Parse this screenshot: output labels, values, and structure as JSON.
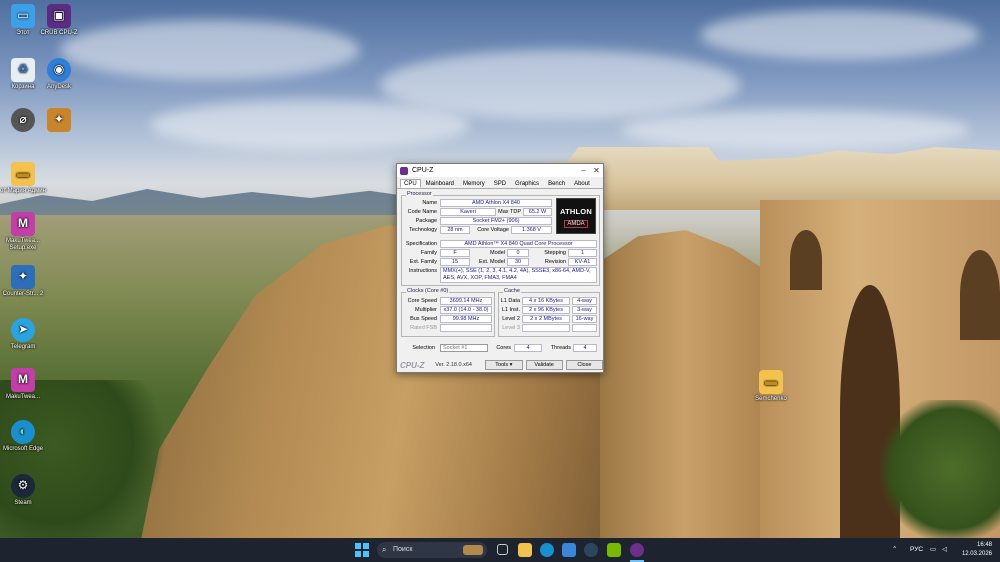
{
  "desktop": {
    "icons": [
      {
        "label": "Этот",
        "icon": "monitor-icon",
        "color": "#3aa0e8"
      },
      {
        "label": "CRUB CPU-Z",
        "icon": "cpu-z-icon",
        "color": "#5a2d82"
      },
      {
        "label": "Корзина",
        "icon": "recycle-bin-icon",
        "color": "#e9eef3"
      },
      {
        "label": "AnyDesk",
        "icon": "anydesk-icon",
        "color": "#2f7fd8"
      },
      {
        "label": "",
        "icon": "app-icon",
        "color": "#555"
      },
      {
        "label": "",
        "icon": "counter-strike-icon",
        "color": "#c9852b"
      },
      {
        "label": "от Мария Админ",
        "icon": "folder-icon",
        "color": "#f2c14e"
      },
      {
        "label": "MakuTwea... Setup.exe",
        "icon": "makutweaker-icon",
        "color": "#c13fa6"
      },
      {
        "label": "Counter-Str... 2",
        "icon": "counter-strike-icon",
        "color": "#2c6fb8"
      },
      {
        "label": "Telegram",
        "icon": "telegram-icon",
        "color": "#2aa3e0"
      },
      {
        "label": "MakuTwea...",
        "icon": "makutweaker-icon",
        "color": "#c13fa6"
      },
      {
        "label": "Microsoft Edge",
        "icon": "edge-icon",
        "color": "#1a8fcf"
      },
      {
        "label": "Steam",
        "icon": "steam-icon",
        "color": "#1b2838"
      },
      {
        "label": "Semchenko",
        "icon": "folder-icon",
        "color": "#f2c14e"
      }
    ]
  },
  "cpuz": {
    "title": "CPU-Z",
    "tabs": [
      "CPU",
      "Mainboard",
      "Memory",
      "SPD",
      "Graphics",
      "Bench",
      "About"
    ],
    "active_tab": "CPU",
    "processor": {
      "group_title": "Processor",
      "name_label": "Name",
      "name": "AMD Athlon X4 840",
      "codename_label": "Code Name",
      "codename": "Kaveri",
      "maxtdp_label": "Max TDP",
      "maxtdp": "65.2 W",
      "package_label": "Package",
      "package": "Socket FM2+ (906)",
      "technology_label": "Technology",
      "technology": "28 nm",
      "corevoltage_label": "Core Voltage",
      "corevoltage": "1.368 V",
      "spec_label": "Specification",
      "spec": "AMD Athlon™ X4 840 Quad Core Processor",
      "family_label": "Family",
      "family": "F",
      "model_label": "Model",
      "model": "0",
      "stepping_label": "Stepping",
      "stepping": "1",
      "extfamily_label": "Ext. Family",
      "extfamily": "15",
      "extmodel_label": "Ext. Model",
      "extmodel": "30",
      "revision_label": "Revision",
      "revision": "KV-A1",
      "instructions_label": "Instructions",
      "instructions": "MMX(+), SSE (1, 2, 3, 4.1, 4.2, 4A), SSSE3, x86-64, AMD-V, AES, AVX, XOP, FMA3, FMA4"
    },
    "logo": {
      "line1": "ATHLON",
      "line2": "AMDA"
    },
    "clocks": {
      "group_title": "Clocks (Core #0)",
      "corespeed_label": "Core Speed",
      "corespeed": "3699.14 MHz",
      "multiplier_label": "Multiplier",
      "multiplier": "x37.0 (14.0 - 38.0)",
      "busspeed_label": "Bus Speed",
      "busspeed": "99.98 MHz",
      "ratedfsb_label": "Rated FSB",
      "ratedfsb": ""
    },
    "cache": {
      "group_title": "Cache",
      "l1data_label": "L1 Data",
      "l1data": "4 x 16 KBytes",
      "l1data_way": "4-way",
      "l1inst_label": "L1 Inst.",
      "l1inst": "2 x 96 KBytes",
      "l1inst_way": "3-way",
      "level2_label": "Level 2",
      "level2": "2 x 2 MBytes",
      "level2_way": "16-way",
      "level3_label": "Level 3",
      "level3": "",
      "level3_way": ""
    },
    "selection_label": "Selection",
    "selection": "Socket #1",
    "cores_label": "Cores",
    "cores": "4",
    "threads_label": "Threads",
    "threads": "4",
    "brand": "CPU-Z",
    "version": "Ver. 2.18.0.x64",
    "tools_label": "Tools",
    "validate_label": "Validate",
    "close_label": "Close"
  },
  "taskbar": {
    "search_placeholder": "Поиск",
    "tray_lang": "РУС",
    "time": "16:48",
    "date": "12.03.2026"
  }
}
